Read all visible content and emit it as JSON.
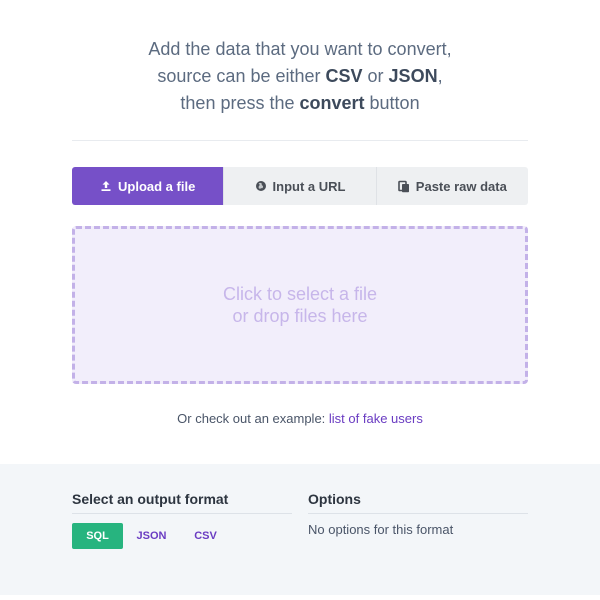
{
  "intro": {
    "line1": "Add the data that you want to convert,",
    "line2_pre": "source can be either ",
    "line2_csv": "CSV",
    "line2_mid": " or ",
    "line2_json": "JSON",
    "line2_post": ",",
    "line3_pre": "then press the ",
    "line3_convert": "convert",
    "line3_post": " button"
  },
  "tabs": [
    {
      "label": "Upload a file",
      "icon": "upload-icon",
      "active": true
    },
    {
      "label": "Input a URL",
      "icon": "globe-icon",
      "active": false
    },
    {
      "label": "Paste raw data",
      "icon": "paste-icon",
      "active": false
    }
  ],
  "dropzone": {
    "line1": "Click to select a file",
    "line2": "or drop files here"
  },
  "example": {
    "prefix": "Or check out an example: ",
    "link": "list of fake users"
  },
  "output": {
    "title": "Select an output format",
    "formats": [
      {
        "label": "SQL",
        "active": true
      },
      {
        "label": "JSON",
        "active": false
      },
      {
        "label": "CSV",
        "active": false
      }
    ]
  },
  "options": {
    "title": "Options",
    "message": "No options for this format"
  },
  "colors": {
    "accent": "#7650c8",
    "active_format": "#27b47f",
    "link": "#6a3cc2"
  }
}
